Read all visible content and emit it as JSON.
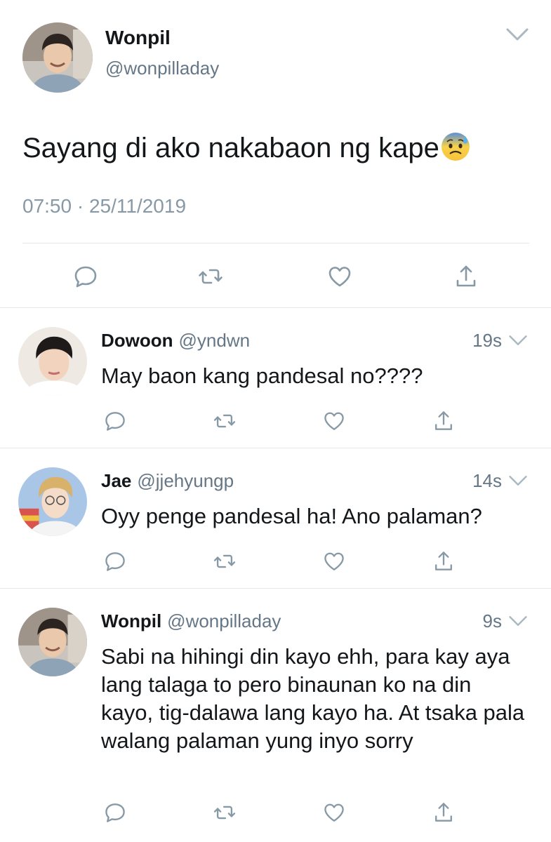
{
  "main_tweet": {
    "name": "Wonpil",
    "handle": "@wonpilladay",
    "text": "Sayang di ako nakabaon ng kape",
    "emoji": "anxious-face-with-sweat",
    "time": "07:50",
    "date": "25/11/2019",
    "avatar": "avatar-wonpil",
    "actions": [
      "reply-icon",
      "retweet-icon",
      "like-icon",
      "share-icon"
    ]
  },
  "replies": [
    {
      "name": "Dowoon",
      "handle": "@yndwn",
      "time": "19s",
      "text": "May baon kang pandesal no????",
      "avatar": "avatar-dowoon"
    },
    {
      "name": "Jae",
      "handle": "@jjehyungp",
      "time": "14s",
      "text": "Oyy penge pandesal ha! Ano palaman?",
      "avatar": "avatar-jae"
    },
    {
      "name": "Wonpil",
      "handle": "@wonpilladay",
      "time": "9s",
      "text": "Sabi na hihingi din kayo ehh, para kay aya lang talaga to pero binaunan ko na din kayo, tig-dalawa lang kayo ha. At tsaka pala walang palaman yung inyo sorry",
      "avatar": "avatar-wonpil"
    }
  ],
  "colors": {
    "text": "#14171a",
    "secondary": "#657786",
    "icon": "#8899a6",
    "divider": "#e1e8ed"
  }
}
